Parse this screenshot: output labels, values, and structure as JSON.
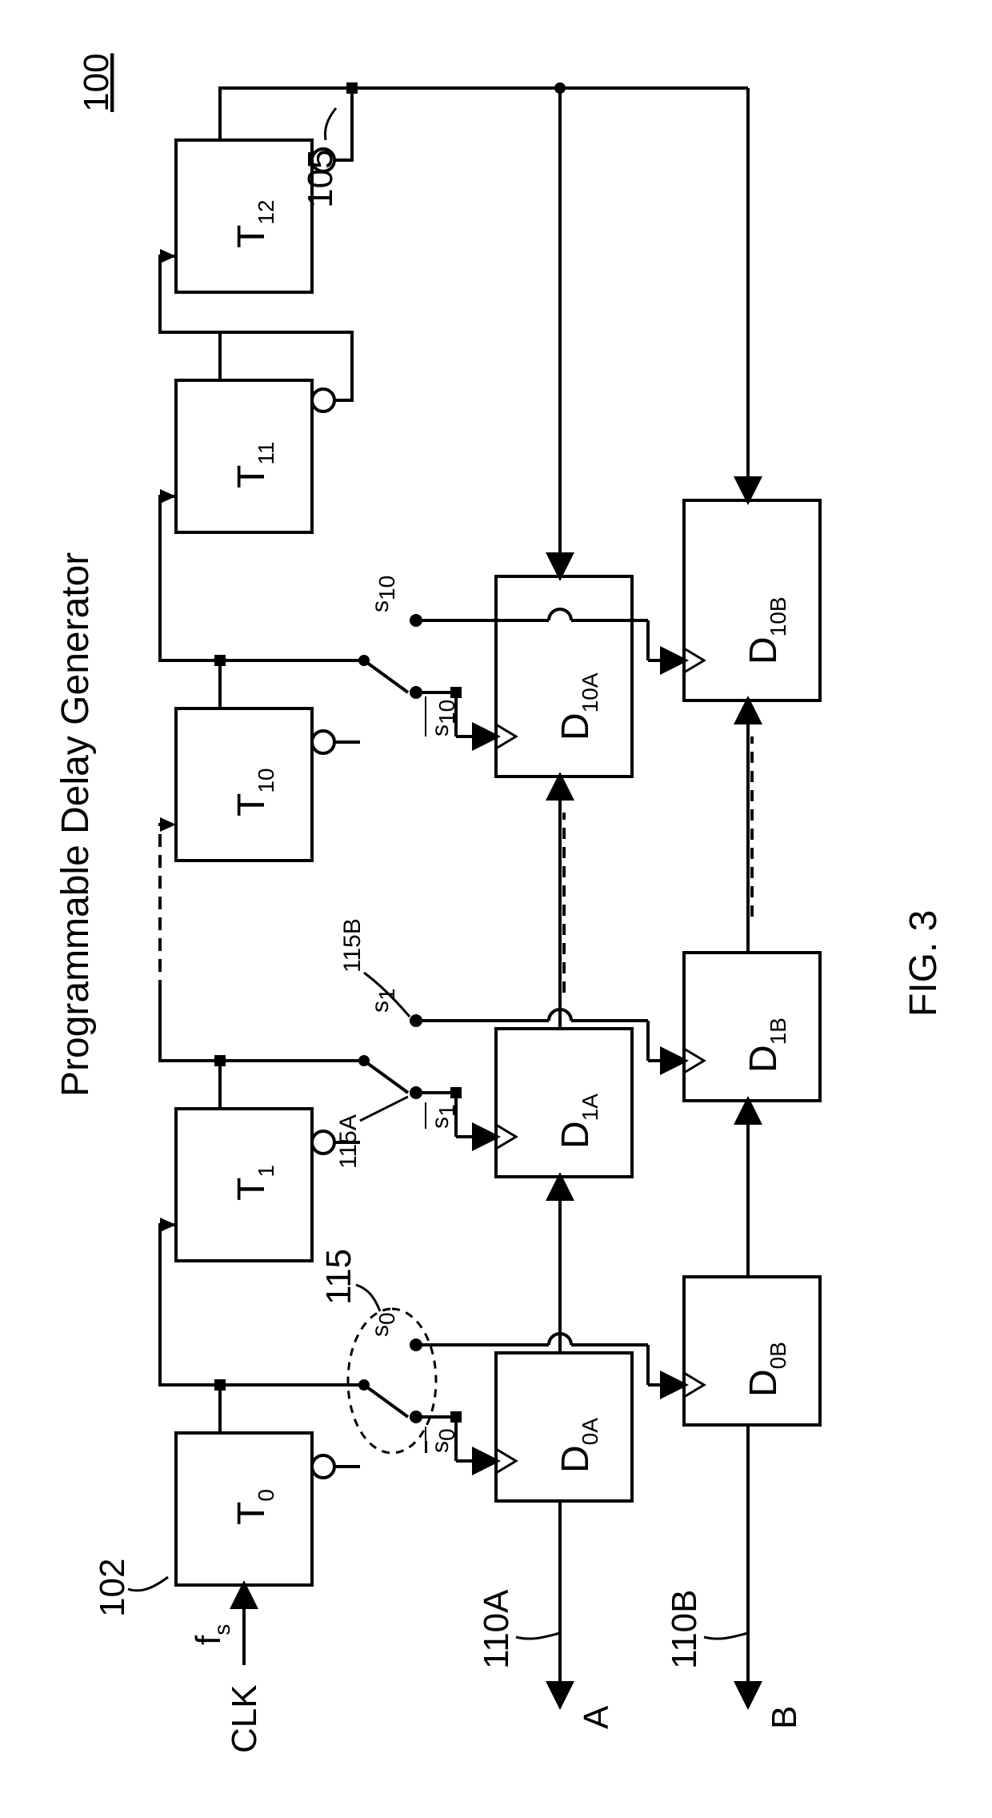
{
  "title": "Programmable Delay Generator",
  "figure_label": "FIG. 3",
  "ref_100": "100",
  "ref_102": "102",
  "ref_105": "105",
  "ref_110A": "110A",
  "ref_110B": "110B",
  "ref_115": "115",
  "ref_115A": "115A",
  "ref_115B": "115B",
  "input_clk": "CLK",
  "input_fs": "f",
  "input_fs_sub": "s",
  "out_A": "A",
  "out_B": "B",
  "T0": "T",
  "T0_sub": "0",
  "T1": "T",
  "T1_sub": "1",
  "T10": "T",
  "T10_sub": "10",
  "T11": "T",
  "T11_sub": "11",
  "T12": "T",
  "T12_sub": "12",
  "D0A": "D",
  "D0A_sub": "0A",
  "D1A": "D",
  "D1A_sub": "1A",
  "D10A": "D",
  "D10A_sub": "10A",
  "D0B": "D",
  "D0B_sub": "0B",
  "D1B": "D",
  "D1B_sub": "1B",
  "D10B": "D",
  "D10B_sub": "10B",
  "s0": "s",
  "s0_sub": "0",
  "s0_bar": "s",
  "s0_bar_sub": "0",
  "s1": "s",
  "s1_sub": "1",
  "s1_bar": "s",
  "s1_bar_sub": "1",
  "s10": "s",
  "s10_sub": "10",
  "s10_bar": "s",
  "s10_bar_sub": "10"
}
